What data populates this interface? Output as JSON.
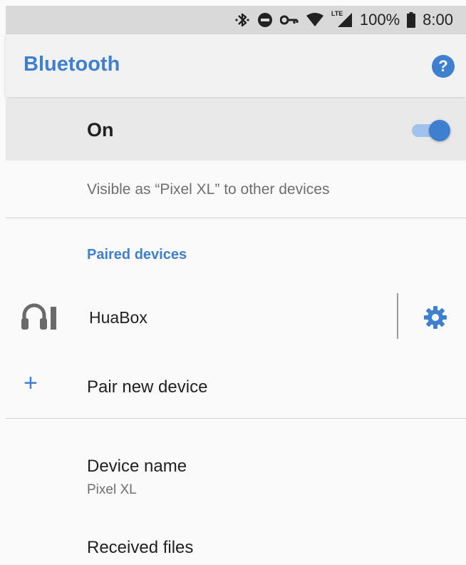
{
  "status_bar": {
    "battery": "100%",
    "time": "8:00",
    "network": "LTE",
    "icons": [
      "bluetooth-icon",
      "do-not-disturb-icon",
      "vpn-key-icon",
      "wifi-icon",
      "cell-signal-icon",
      "battery-icon"
    ]
  },
  "app_bar": {
    "title": "Bluetooth",
    "help_glyph": "?"
  },
  "toggle_row": {
    "label": "On",
    "enabled": true
  },
  "visible_text": "Visible as “Pixel XL” to other devices",
  "paired": {
    "header": "Paired devices",
    "devices": [
      {
        "name": "HuaBox",
        "icon": "headset-battery-icon"
      }
    ]
  },
  "pair_new": {
    "label": "Pair new device",
    "icon_glyph": "+"
  },
  "device_name": {
    "label": "Device name",
    "value": "Pixel XL"
  },
  "received_files": {
    "label": "Received files"
  },
  "colors": {
    "accent": "#3f7fcf",
    "toggle_track": "#9fc3ea"
  }
}
